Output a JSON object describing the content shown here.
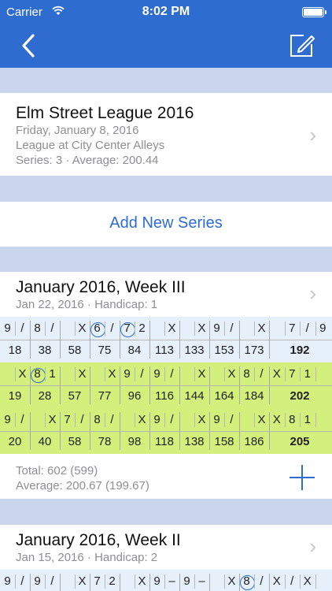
{
  "status_bar": {
    "carrier": "Carrier",
    "time": "8:02 PM"
  },
  "league": {
    "title": "Elm Street League 2016",
    "date": "Friday, January 8, 2016",
    "location": "League at City Center Alleys",
    "summary": "Series: 3 · Average: 200.44"
  },
  "add_series_label": "Add New Series",
  "series": [
    {
      "title": "January 2016, Week III",
      "subtitle": "Jan 22, 2016 · Handicap: 1",
      "games": [
        {
          "highlight": "blue",
          "frames": [
            {
              "balls": [
                "9",
                "/"
              ],
              "score": "18"
            },
            {
              "balls": [
                "8",
                "/"
              ],
              "score": "38"
            },
            {
              "balls": [
                "X"
              ],
              "score": "58"
            },
            {
              "balls": [
                "6",
                "/"
              ],
              "circled": [
                0
              ],
              "score": "75"
            },
            {
              "balls": [
                "7",
                "2"
              ],
              "circled": [
                0
              ],
              "score": "84"
            },
            {
              "balls": [
                "X"
              ],
              "score": "113"
            },
            {
              "balls": [
                "X"
              ],
              "score": "133"
            },
            {
              "balls": [
                "9",
                "/"
              ],
              "score": "153"
            },
            {
              "balls": [
                "X"
              ],
              "score": "173"
            },
            {
              "balls": [
                "",
                "7",
                "/",
                "9"
              ],
              "score": "192"
            }
          ]
        },
        {
          "highlight": "green",
          "frames": [
            {
              "balls": [
                "X"
              ],
              "score": "19"
            },
            {
              "balls": [
                "8",
                "1"
              ],
              "circled": [
                0
              ],
              "score": "28"
            },
            {
              "balls": [
                "X"
              ],
              "score": "57"
            },
            {
              "balls": [
                "X"
              ],
              "score": "77"
            },
            {
              "balls": [
                "9",
                "/"
              ],
              "score": "96"
            },
            {
              "balls": [
                "9",
                "/"
              ],
              "score": "116"
            },
            {
              "balls": [
                "X"
              ],
              "score": "144"
            },
            {
              "balls": [
                "X"
              ],
              "score": "164"
            },
            {
              "balls": [
                "8",
                "/"
              ],
              "score": "184"
            },
            {
              "balls": [
                "X",
                "7",
                "1"
              ],
              "score": "202"
            }
          ]
        },
        {
          "highlight": "green",
          "frames": [
            {
              "balls": [
                "9",
                "/"
              ],
              "score": "20"
            },
            {
              "balls": [
                "X"
              ],
              "score": "40"
            },
            {
              "balls": [
                "7",
                "/"
              ],
              "score": "58"
            },
            {
              "balls": [
                "8",
                "/"
              ],
              "score": "78"
            },
            {
              "balls": [
                "X"
              ],
              "score": "98"
            },
            {
              "balls": [
                "9",
                "/"
              ],
              "score": "118"
            },
            {
              "balls": [
                "X"
              ],
              "score": "138"
            },
            {
              "balls": [
                "9",
                "/"
              ],
              "score": "158"
            },
            {
              "balls": [
                "X"
              ],
              "score": "186"
            },
            {
              "balls": [
                "X",
                "8",
                "1"
              ],
              "score": "205"
            }
          ]
        }
      ],
      "total": "Total: 602 (599)",
      "average": "Average: 200.67 (199.67)"
    },
    {
      "title": "January 2016, Week II",
      "subtitle": "Jan 15, 2016 · Handicap: 2",
      "games": [
        {
          "highlight": "blue",
          "frames": [
            {
              "balls": [
                "9",
                "/"
              ],
              "score": ""
            },
            {
              "balls": [
                "9",
                "/"
              ],
              "score": ""
            },
            {
              "balls": [
                "X"
              ],
              "score": ""
            },
            {
              "balls": [
                "7",
                "2"
              ],
              "score": ""
            },
            {
              "balls": [
                "X"
              ],
              "score": ""
            },
            {
              "balls": [
                "9",
                "–"
              ],
              "score": ""
            },
            {
              "balls": [
                "9",
                "–"
              ],
              "score": ""
            },
            {
              "balls": [
                "X"
              ],
              "score": ""
            },
            {
              "balls": [
                "8",
                "/"
              ],
              "circled": [
                0
              ],
              "score": ""
            },
            {
              "balls": [
                "X",
                "/",
                "X"
              ],
              "score": ""
            }
          ]
        }
      ]
    }
  ]
}
